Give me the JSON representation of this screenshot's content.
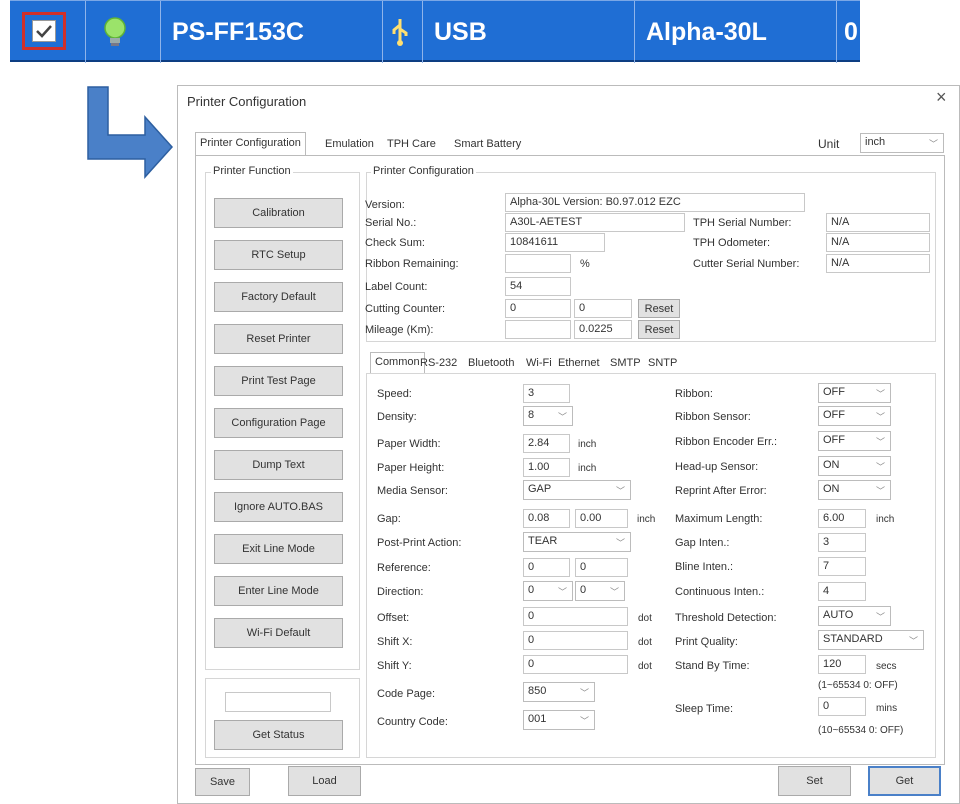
{
  "row": {
    "model": "PS-FF153C",
    "interface": "USB",
    "printer": "Alpha-30L",
    "extra": "0"
  },
  "window": {
    "title": "Printer Configuration",
    "close": "×"
  },
  "tabs": [
    "Printer Configuration",
    "Emulation",
    "TPH Care",
    "Smart Battery"
  ],
  "unit": {
    "label": "Unit",
    "value": "inch"
  },
  "left": {
    "group": "Printer Function",
    "buttons": [
      "Calibration",
      "RTC Setup",
      "Factory Default",
      "Reset Printer",
      "Print Test Page",
      "Configuration Page",
      "Dump Text",
      "Ignore AUTO.BAS",
      "Exit Line Mode",
      "Enter Line Mode",
      "Wi-Fi Default"
    ],
    "status_value": "",
    "get_status": "Get Status"
  },
  "info": {
    "group": "Printer Configuration",
    "version_label": "Version:",
    "version": "Alpha-30L Version: B0.97.012 EZC",
    "serial_label": "Serial No.:",
    "serial": "A30L-AETEST",
    "checksum_label": "Check Sum:",
    "checksum": "10841611",
    "ribbon_label": "Ribbon Remaining:",
    "ribbon_value": "",
    "ribbon_unit": "%",
    "label_count_label": "Label Count:",
    "label_count": "54",
    "cutting_label": "Cutting Counter:",
    "cutting1": "0",
    "cutting2": "0",
    "mileage_label": "Mileage (Km):",
    "mileage1": "",
    "mileage2": "0.0225",
    "reset": "Reset",
    "tph_serial_label": "TPH Serial Number:",
    "tph_serial": "N/A",
    "tph_odo_label": "TPH Odometer:",
    "tph_odo": "N/A",
    "cutter_serial_label": "Cutter Serial Number:",
    "cutter_serial": "N/A"
  },
  "subtabs": [
    "Common",
    "RS-232",
    "Bluetooth",
    "Wi-Fi",
    "Ethernet",
    "SMTP",
    "SNTP"
  ],
  "common": {
    "speed_label": "Speed:",
    "speed": "3",
    "density_label": "Density:",
    "density": "8",
    "pw_label": "Paper Width:",
    "pw": "2.84",
    "pw_unit": "inch",
    "ph_label": "Paper Height:",
    "ph": "1.00",
    "ph_unit": "inch",
    "media_label": "Media Sensor:",
    "media": "GAP",
    "gap_label": "Gap:",
    "gap1": "0.08",
    "gap2": "0.00",
    "gap_unit": "inch",
    "ppa_label": "Post-Print Action:",
    "ppa": "TEAR",
    "ref_label": "Reference:",
    "ref1": "0",
    "ref2": "0",
    "dir_label": "Direction:",
    "dir1": "0",
    "dir2": "0",
    "offset_label": "Offset:",
    "offset": "0",
    "offset_unit": "dot",
    "sx_label": "Shift X:",
    "sx": "0",
    "sx_unit": "dot",
    "sy_label": "Shift Y:",
    "sy": "0",
    "sy_unit": "dot",
    "cp_label": "Code Page:",
    "cp": "850",
    "cc_label": "Country Code:",
    "cc": "001",
    "ribbon_label": "Ribbon:",
    "ribbon": "OFF",
    "rsensor_label": "Ribbon Sensor:",
    "rsensor": "OFF",
    "renc_label": "Ribbon Encoder Err.:",
    "renc": "OFF",
    "hu_label": "Head-up Sensor:",
    "hu": "ON",
    "rae_label": "Reprint After Error:",
    "rae": "ON",
    "ml_label": "Maximum Length:",
    "ml": "6.00",
    "ml_unit": "inch",
    "gi_label": "Gap Inten.:",
    "gi": "3",
    "bi_label": "Bline Inten.:",
    "bi": "7",
    "ci_label": "Continuous Inten.:",
    "ci": "4",
    "td_label": "Threshold Detection:",
    "td": "AUTO",
    "pq_label": "Print Quality:",
    "pq": "STANDARD",
    "sbt_label": "Stand By Time:",
    "sbt": "120",
    "sbt_unit": "secs",
    "sbt_range": "(1~65534 0: OFF)",
    "st_label": "Sleep Time:",
    "st": "0",
    "st_unit": "mins",
    "st_range": "(10~65534 0: OFF)"
  },
  "bottom": {
    "save": "Save",
    "load": "Load",
    "set": "Set",
    "get": "Get"
  }
}
